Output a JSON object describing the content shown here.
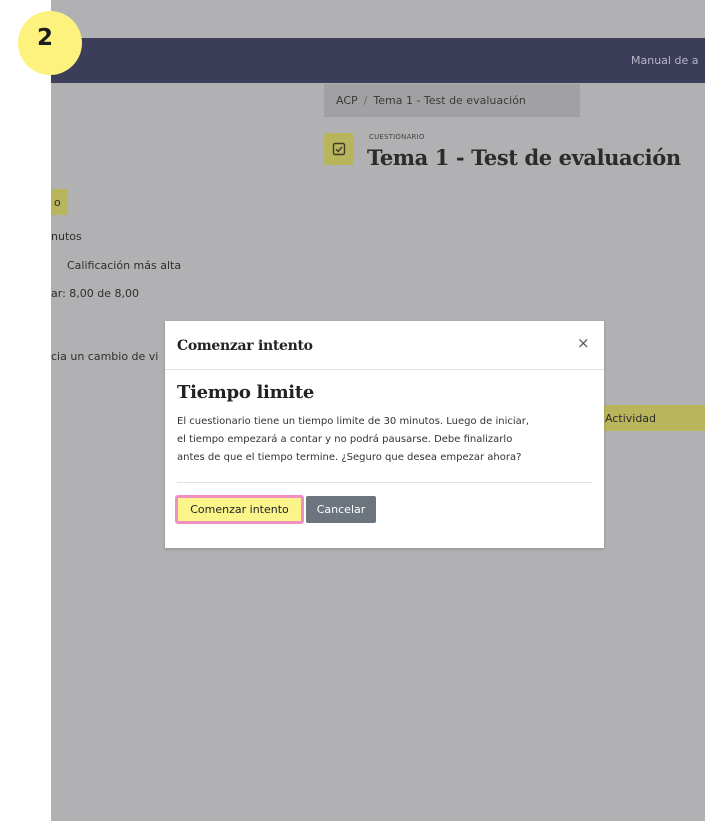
{
  "step": "2",
  "header": {
    "manual_link": "Manual de a"
  },
  "breadcrumb": {
    "course": "ACP",
    "separator": "/",
    "current": "Tema 1 - Test de evaluación"
  },
  "activity": {
    "type_label": "CUESTIONARIO",
    "title": "Tema 1 - Test de evaluación",
    "icon": "checkbox-icon"
  },
  "left_column": {
    "button_fragment": "o",
    "lines": [
      "nutos",
      "Calificación más alta",
      "ar: 8,00 de 8,00",
      "cia un cambio de vi"
    ]
  },
  "right_button": "Actividad",
  "modal": {
    "title": "Comenzar intento",
    "close_symbol": "×",
    "heading": "Tiempo limite",
    "body_lines": [
      "El cuestionario tiene un tiempo limite de 30 minutos. Luego de iniciar,",
      "el tiempo empezará a contar y no podrá pausarse. Debe finalizarlo",
      "antes de que el tiempo termine. ¿Seguro que desea empezar ahora?"
    ],
    "start_label": "Comenzar intento",
    "cancel_label": "Cancelar"
  },
  "colors": {
    "topbar": "#3b3d59",
    "overlay": "#b1b1b3",
    "accent": "#b9b55d",
    "highlight": "#fbf48a",
    "highlight_border": "#f08fc0",
    "secondary_button": "#6c757d",
    "badge": "#fdf27e"
  }
}
